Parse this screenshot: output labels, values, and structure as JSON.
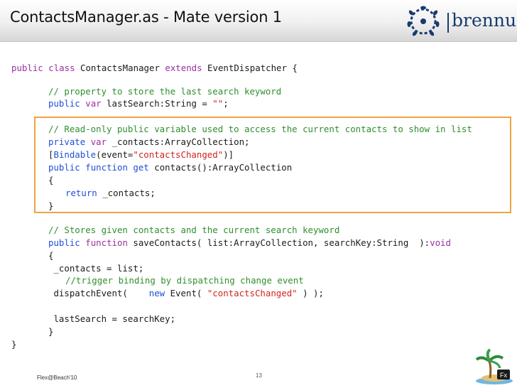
{
  "slide": {
    "title": "ContactsManager.as - Mate version 1",
    "logo_text": "brennus",
    "footer_left": "Flex@Beach'10",
    "page_number": "13",
    "badge_text": "Fx"
  },
  "code": {
    "l1": {
      "a": "public",
      "b": " ",
      "c": "class",
      "d": " ContactsManager ",
      "e": "extends",
      "f": " EventDispatcher {"
    },
    "l2": {
      "c": "// property to store the last search keyword"
    },
    "l3": {
      "a": "public",
      "b": " ",
      "c": "var",
      "d": " lastSearch:String = ",
      "e": "\"\"",
      "f": ";"
    },
    "l4": {
      "c": "// Read-only public variable used to access the current contacts to show in list"
    },
    "l5": {
      "a": "private",
      "b": " ",
      "c": "var",
      "d": " _contacts:ArrayCollection;"
    },
    "l6": {
      "a": "[",
      "b": "Bindable",
      "c": "(event=",
      "d": "\"contactsChanged\"",
      "e": ")]"
    },
    "l7": {
      "a": "public",
      "b": " ",
      "c": "function",
      "d": " ",
      "e": "get",
      "f": " contacts():ArrayCollection"
    },
    "l8": "{",
    "l9": {
      "a": "return",
      "b": " _contacts;"
    },
    "l10": "}",
    "l11": {
      "c": "// Stores given contacts and the current search keyword"
    },
    "l12": {
      "a": "public",
      "b": " ",
      "c": "function",
      "d": " saveContacts( list:ArrayCollection, searchKey:String  ):",
      "e": "void"
    },
    "l13": "{",
    "l14": " _contacts = list;",
    "l15": {
      "c": "//trigger binding by dispatching change event"
    },
    "l16": {
      "a": " dispatchEvent(    ",
      "b": "new",
      "c": " Event( ",
      "d": "\"contactsChanged\"",
      "e": " ) );"
    },
    "l17": " lastSearch = searchKey;",
    "l18": "}",
    "l19": "}"
  },
  "colors": {
    "keyword": "#9b2fa0",
    "builtin": "#1f4fd6",
    "comment": "#2f8f2f",
    "string": "#d2241c",
    "highlight_box": "#f0a442",
    "logo": "#1a3a6e"
  }
}
